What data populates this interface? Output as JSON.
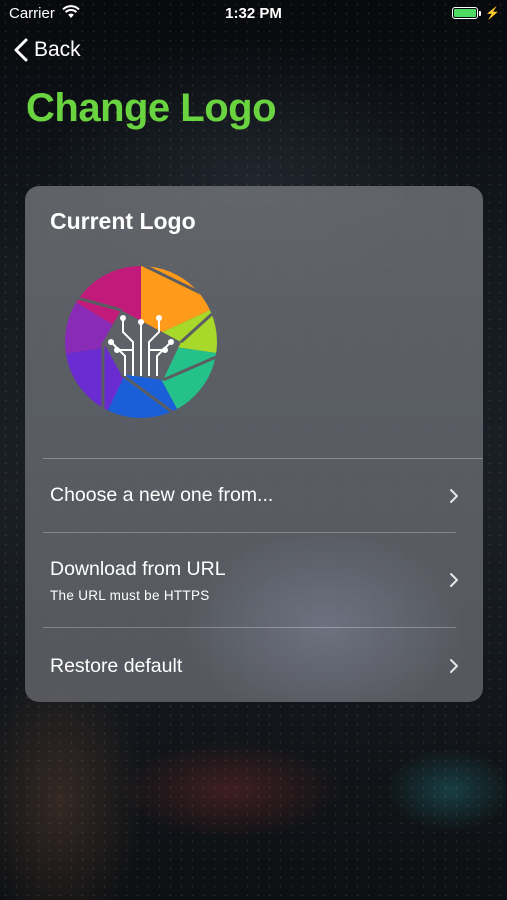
{
  "status_bar": {
    "carrier": "Carrier",
    "time": "1:32 PM",
    "battery_color": "#4cd964"
  },
  "nav": {
    "back_label": "Back",
    "title": "Change Logo",
    "title_color": "#6ad440"
  },
  "card": {
    "title": "Current Logo",
    "rows": [
      {
        "label": "Choose a new one from...",
        "icon": "chevron-right-icon"
      },
      {
        "label": "Download from URL",
        "subtitle": "The URL must be HTTPS",
        "icon": "chevron-right-icon"
      },
      {
        "label": "Restore default",
        "icon": "chevron-right-icon"
      }
    ]
  }
}
